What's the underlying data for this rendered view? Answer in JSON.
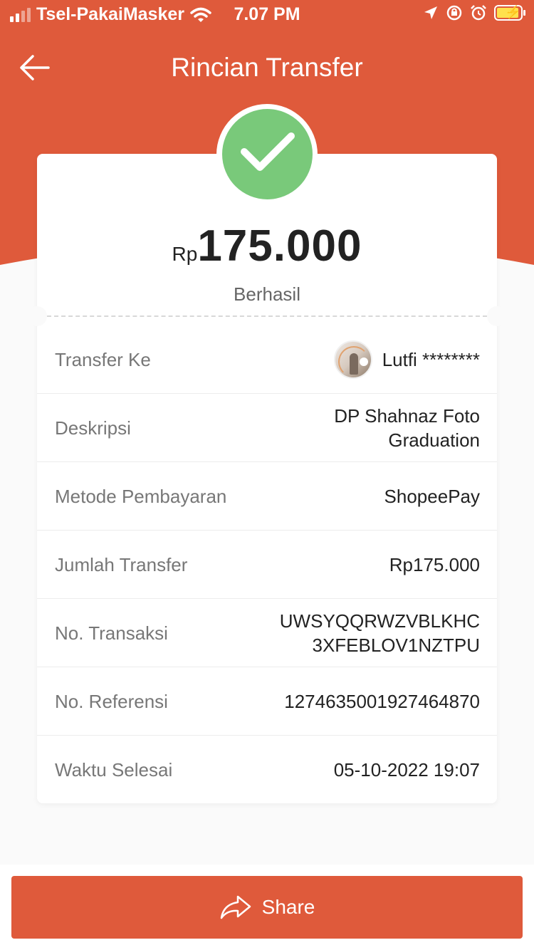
{
  "status_bar": {
    "carrier": "Tsel-PakaiMasker",
    "time": "7.07 PM"
  },
  "header": {
    "title": "Rincian Transfer"
  },
  "summary": {
    "currency": "Rp",
    "amount": "175.000",
    "status": "Berhasil"
  },
  "details": {
    "transfer_to": {
      "label": "Transfer Ke",
      "value": "Lutfi ********"
    },
    "description": {
      "label": "Deskripsi",
      "line1": "DP Shahnaz Foto",
      "line2": "Graduation"
    },
    "payment_method": {
      "label": "Metode Pembayaran",
      "value": "ShopeePay"
    },
    "transfer_amount": {
      "label": "Jumlah Transfer",
      "value": "Rp175.000"
    },
    "transaction_no": {
      "label": "No. Transaksi",
      "line1": "UWSYQQRWZVBLKHC",
      "line2": "3XFEBLOV1NZTPU"
    },
    "reference_no": {
      "label": "No. Referensi",
      "value": "1274635001927464870"
    },
    "completed_time": {
      "label": "Waktu Selesai",
      "value": "05-10-2022 19:07"
    }
  },
  "actions": {
    "share_label": "Share"
  },
  "colors": {
    "brand": "#df5a3b",
    "success": "#79c97a",
    "battery_charge": "#ffe14d"
  },
  "icons": [
    "signal-icon",
    "wifi-icon",
    "location-icon",
    "rotation-lock-icon",
    "alarm-icon",
    "battery-icon",
    "back-arrow-icon",
    "check-icon",
    "share-icon"
  ]
}
